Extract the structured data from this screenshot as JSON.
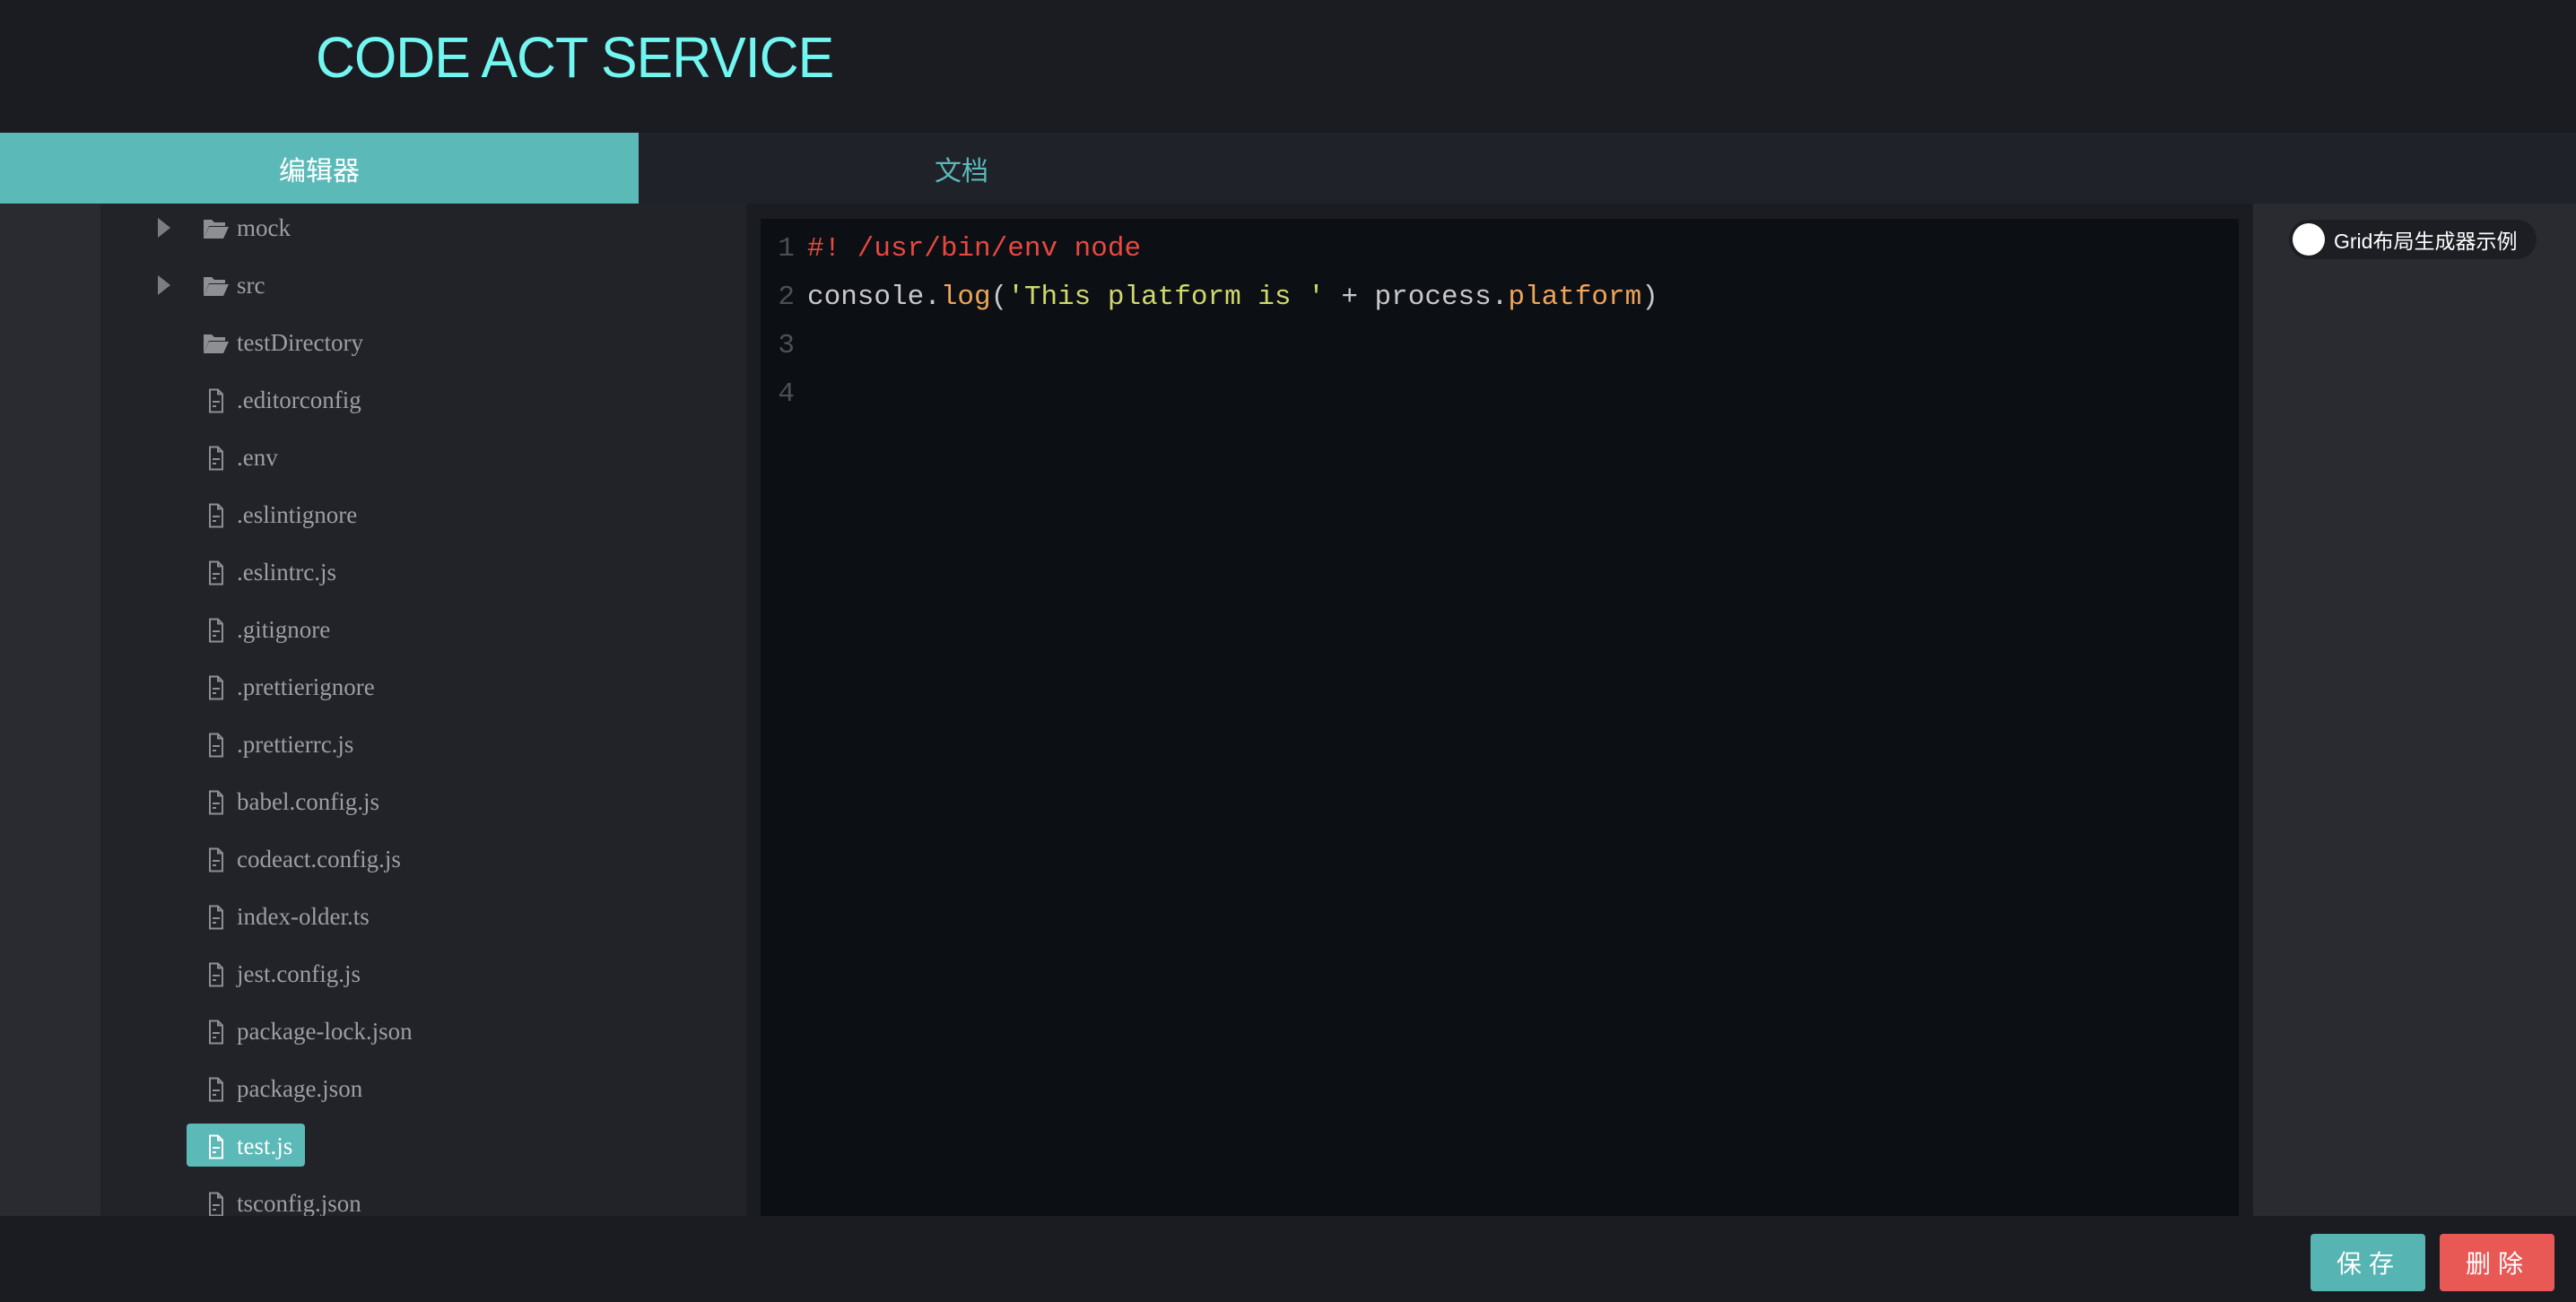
{
  "app": {
    "title": "CODE ACT SERVICE"
  },
  "tabs": [
    {
      "label": "编辑器",
      "active": true
    },
    {
      "label": "文档",
      "active": false
    }
  ],
  "file_tree": {
    "items": [
      {
        "name": "mock",
        "type": "folder",
        "expandable": true
      },
      {
        "name": "src",
        "type": "folder",
        "expandable": true
      },
      {
        "name": "testDirectory",
        "type": "folder",
        "expandable": false
      },
      {
        "name": ".editorconfig",
        "type": "file"
      },
      {
        "name": ".env",
        "type": "file"
      },
      {
        "name": ".eslintignore",
        "type": "file"
      },
      {
        "name": ".eslintrc.js",
        "type": "file"
      },
      {
        "name": ".gitignore",
        "type": "file"
      },
      {
        "name": ".prettierignore",
        "type": "file"
      },
      {
        "name": ".prettierrc.js",
        "type": "file"
      },
      {
        "name": "babel.config.js",
        "type": "file"
      },
      {
        "name": "codeact.config.js",
        "type": "file"
      },
      {
        "name": "index-older.ts",
        "type": "file"
      },
      {
        "name": "jest.config.js",
        "type": "file"
      },
      {
        "name": "package-lock.json",
        "type": "file"
      },
      {
        "name": "package.json",
        "type": "file"
      },
      {
        "name": "test.js",
        "type": "file",
        "selected": true
      },
      {
        "name": "tsconfig.json",
        "type": "file"
      }
    ]
  },
  "editor": {
    "lines": [
      {
        "number": "1",
        "tokens": [
          {
            "text": "#! /usr/bin/env node",
            "kind": "comment"
          }
        ]
      },
      {
        "number": "2",
        "tokens": [
          {
            "text": "console.",
            "kind": "plain"
          },
          {
            "text": "log",
            "kind": "fn"
          },
          {
            "text": "(",
            "kind": "plain"
          },
          {
            "text": "'This platform is '",
            "kind": "str"
          },
          {
            "text": " + process.",
            "kind": "plain"
          },
          {
            "text": "platform",
            "kind": "fn"
          },
          {
            "text": ")",
            "kind": "plain"
          }
        ]
      },
      {
        "number": "3",
        "tokens": []
      },
      {
        "number": "4",
        "tokens": []
      }
    ]
  },
  "right_panel": {
    "toggle_label": "Grid布局生成器示例",
    "toggle_on": false
  },
  "footer": {
    "save_label": "保存",
    "delete_label": "删除"
  },
  "colors": {
    "accent": "#5bb9b8",
    "title": "#72f6f1",
    "danger": "#e85855"
  }
}
